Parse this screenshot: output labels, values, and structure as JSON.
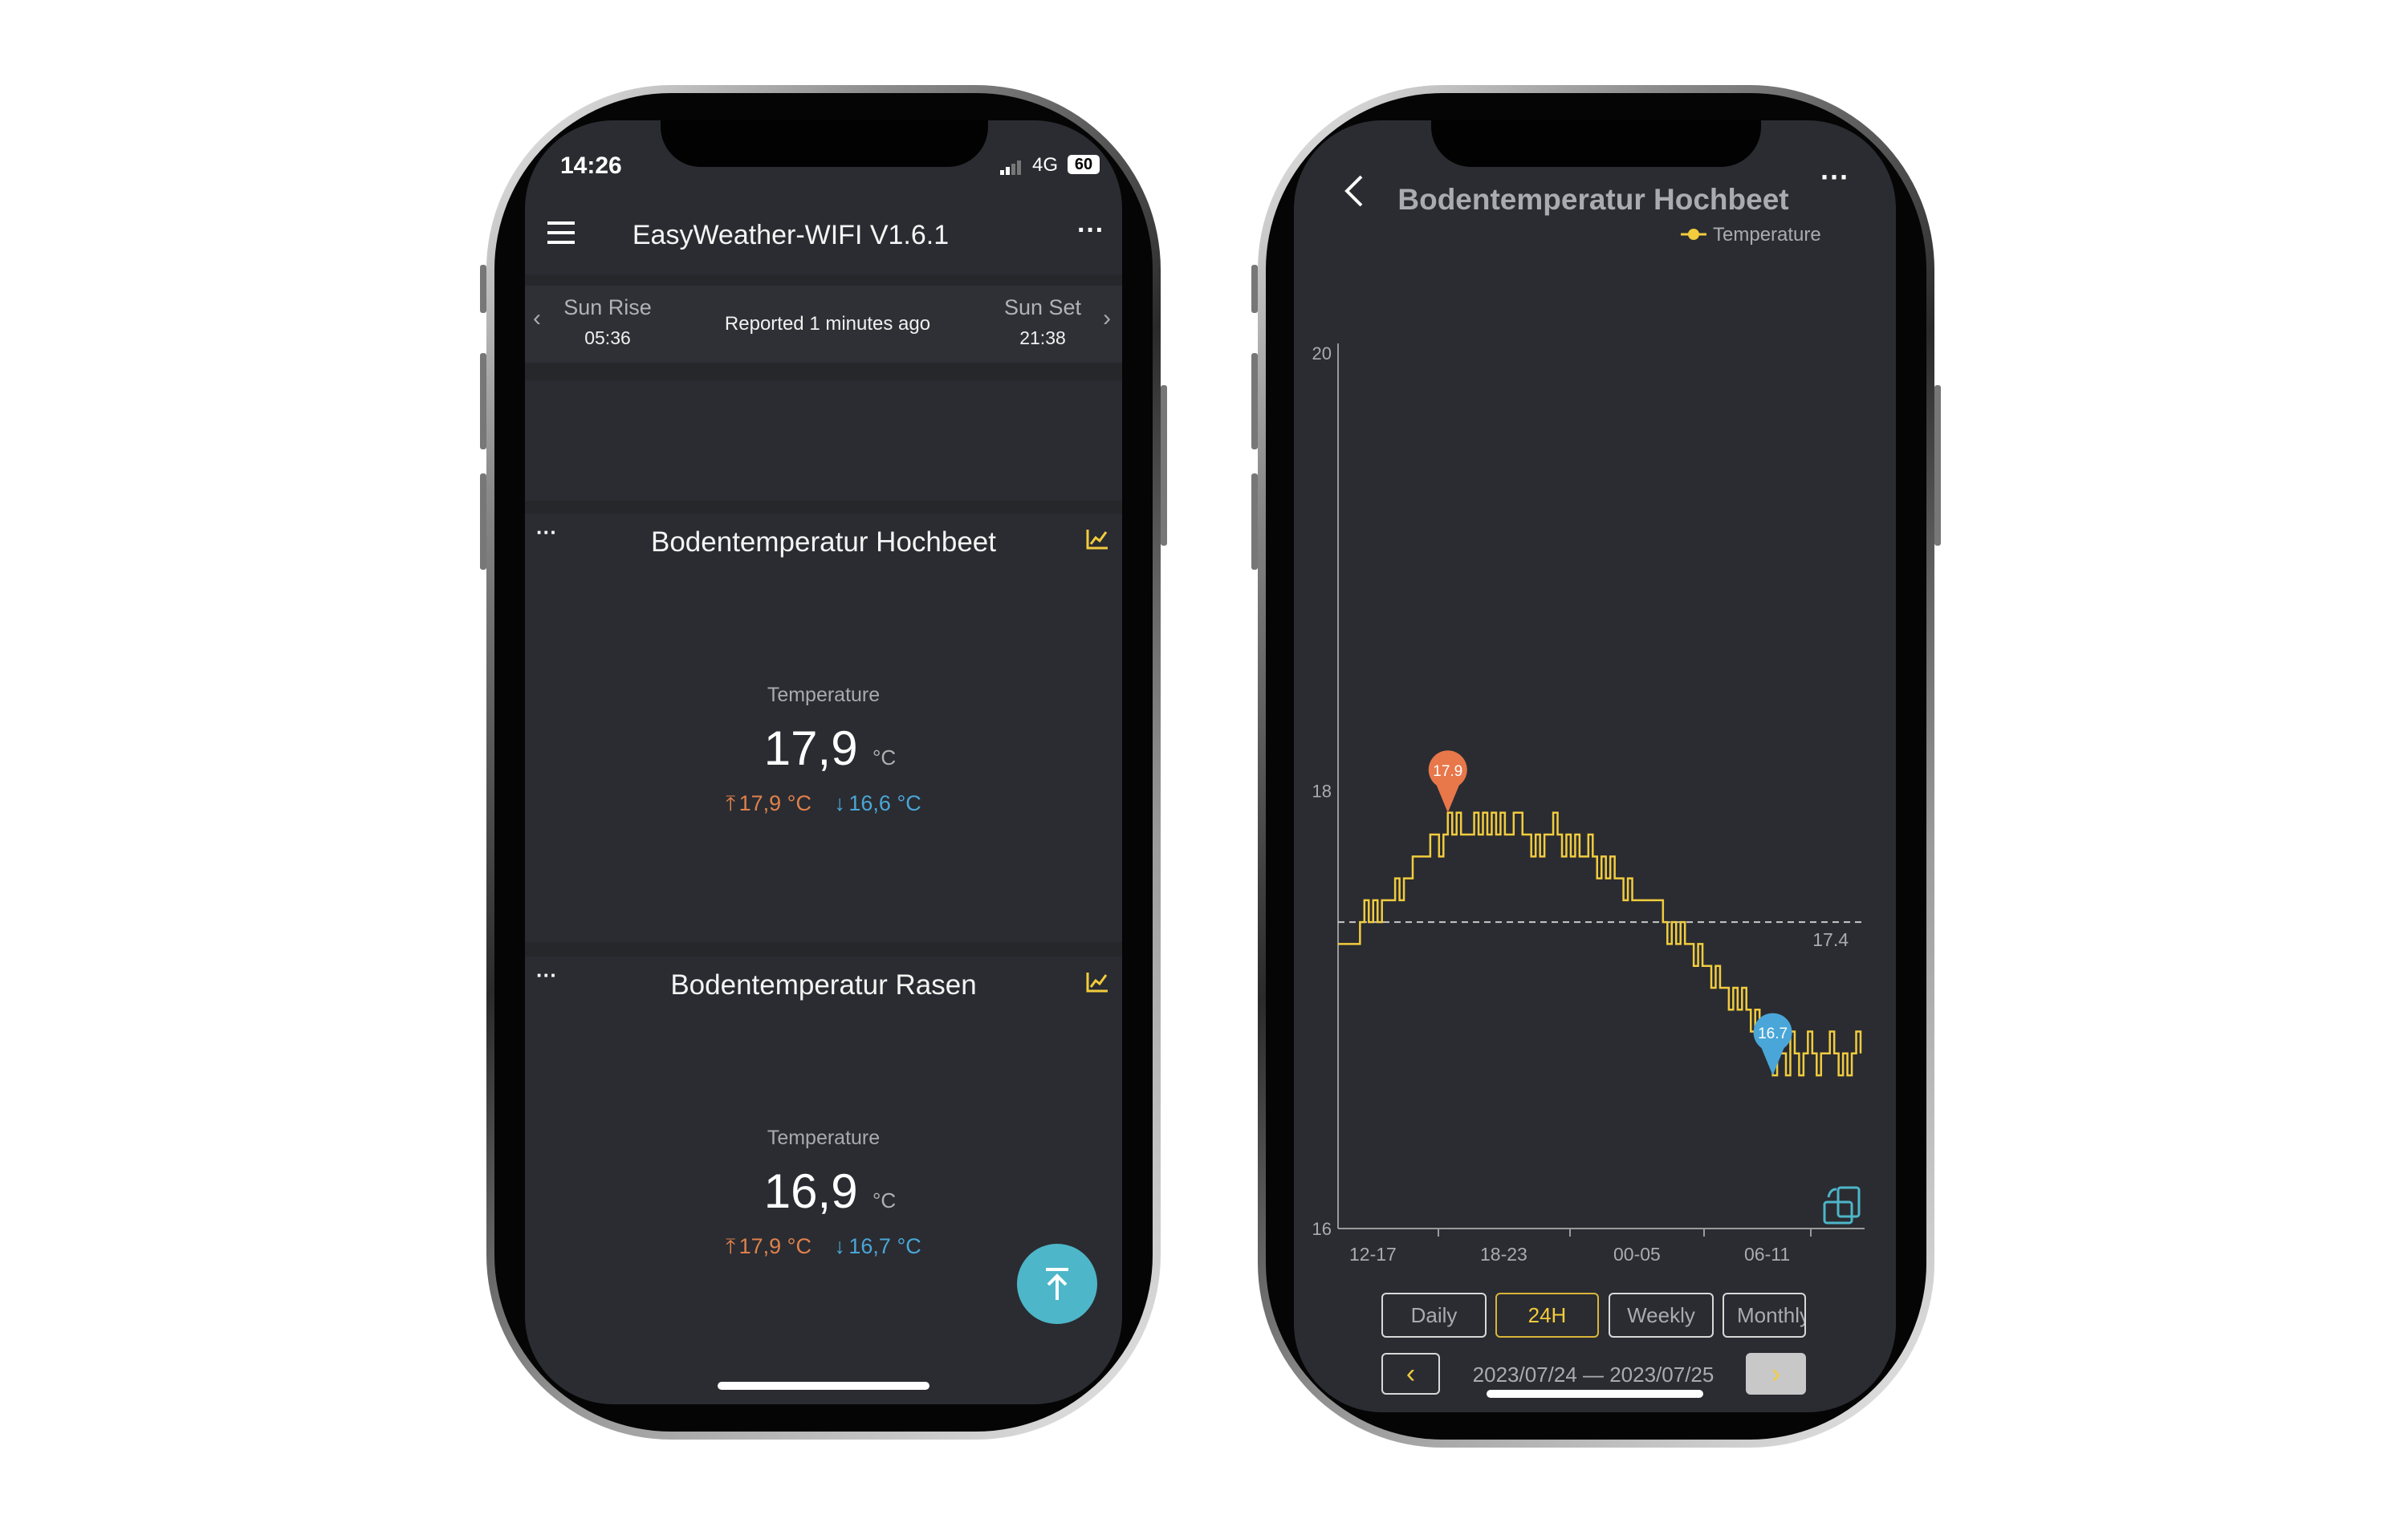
{
  "left_phone": {
    "status": {
      "time": "14:26",
      "network": "4G",
      "battery": "60"
    },
    "header": {
      "title": "EasyWeather-WIFI V1.6.1",
      "menu_icon": "hamburger-icon",
      "more_icon": "more-icon"
    },
    "sun": {
      "rise_label": "Sun Rise",
      "rise_time": "05:36",
      "reported": "Reported 1 minutes ago",
      "set_label": "Sun Set",
      "set_time": "21:38"
    },
    "cards": [
      {
        "title": "Bodentemperatur Hochbeet",
        "label": "Temperature",
        "value": "17,9",
        "unit": "°C",
        "max": "17,9 °C",
        "min": "16,6 °C"
      },
      {
        "title": "Bodentemperatur Rasen",
        "label": "Temperature",
        "value": "16,9",
        "unit": "°C",
        "max": "17,9 °C",
        "min": "16,7 °C"
      }
    ],
    "more_dots": "···",
    "up_arrow": "⤒",
    "down_arrow": "↓"
  },
  "right_phone": {
    "header": {
      "title": "Bodentemperatur Hochbeet",
      "back_icon": "chevron-left-icon",
      "more_icon": "more-icon"
    },
    "ranges": {
      "items": [
        "Daily",
        "24H",
        "Weekly",
        "Monthly"
      ],
      "selected": "24H"
    },
    "date_range": "2023/07/24 — 2023/07/25"
  },
  "colors": {
    "accent": "#f2cc3e",
    "max": "#e8774a",
    "min": "#4aa6d8",
    "fab": "#4db6c9",
    "background": "#2a2c31"
  },
  "chart_data": {
    "type": "line",
    "legend": [
      "Temperature"
    ],
    "legend_placement": "top-right",
    "ylim": [
      16,
      20
    ],
    "y_ticks": [
      "16",
      "18",
      "20"
    ],
    "x_ticks": [
      "12-17",
      "18-23",
      "00-05",
      "06-11"
    ],
    "average": {
      "value": 17.4,
      "label": "17.4"
    },
    "max_marker": "17.9",
    "min_marker": "16.7",
    "series": [
      {
        "name": "Temperature",
        "values": [
          17.3,
          17.3,
          17.3,
          17.3,
          17.3,
          17.4,
          17.5,
          17.4,
          17.5,
          17.4,
          17.5,
          17.5,
          17.5,
          17.6,
          17.5,
          17.6,
          17.6,
          17.7,
          17.7,
          17.7,
          17.7,
          17.8,
          17.8,
          17.7,
          17.8,
          17.9,
          17.8,
          17.9,
          17.8,
          17.8,
          17.8,
          17.9,
          17.8,
          17.9,
          17.8,
          17.9,
          17.8,
          17.9,
          17.8,
          17.8,
          17.9,
          17.9,
          17.8,
          17.8,
          17.7,
          17.8,
          17.7,
          17.8,
          17.8,
          17.9,
          17.8,
          17.7,
          17.8,
          17.7,
          17.8,
          17.7,
          17.7,
          17.8,
          17.7,
          17.6,
          17.7,
          17.6,
          17.7,
          17.6,
          17.6,
          17.5,
          17.6,
          17.5,
          17.5,
          17.5,
          17.5,
          17.5,
          17.5,
          17.5,
          17.4,
          17.3,
          17.4,
          17.3,
          17.4,
          17.3,
          17.3,
          17.2,
          17.3,
          17.2,
          17.2,
          17.1,
          17.2,
          17.1,
          17.1,
          17.0,
          17.1,
          17.0,
          17.1,
          17.0,
          16.9,
          17.0,
          16.9,
          16.9,
          16.8,
          16.7,
          16.8,
          16.8,
          16.7,
          16.9,
          16.8,
          16.7,
          16.8,
          16.9,
          16.8,
          16.7,
          16.8,
          16.8,
          16.9,
          16.8,
          16.7,
          16.8,
          16.7,
          16.8,
          16.9,
          16.8
        ]
      }
    ]
  }
}
